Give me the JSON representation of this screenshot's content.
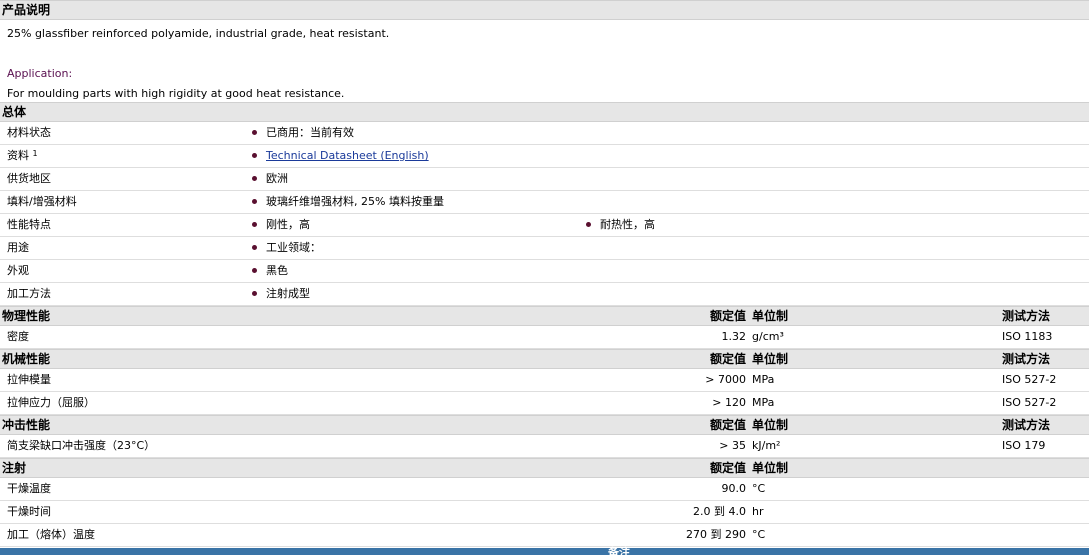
{
  "description": {
    "title": "产品说明",
    "line1": "25% glassfiber reinforced polyamide, industrial grade, heat resistant.",
    "app_label": "Application:",
    "app_text": "For moulding parts with high rigidity at good heat resistance."
  },
  "general": {
    "title": "总体",
    "rows": [
      {
        "label": "材料状态",
        "value": "已商用：当前有效"
      },
      {
        "label": "资料",
        "sup": "1",
        "value": "Technical Datasheet (English)"
      },
      {
        "label": "供货地区",
        "value": "欧洲"
      },
      {
        "label": "填料/增强材料",
        "value": "玻璃纤维增强材料, 25% 填料按重量"
      },
      {
        "label": "性能特点",
        "value": "刚性，高",
        "value2": "耐热性，高"
      },
      {
        "label": "用途",
        "value": "工业领域："
      },
      {
        "label": "外观",
        "value": "黑色"
      },
      {
        "label": "加工方法",
        "value": "注射成型"
      }
    ]
  },
  "headers": {
    "nominal": "额定值",
    "unit": "单位制",
    "test": "测试方法"
  },
  "physical": {
    "title": "物理性能",
    "rows": [
      {
        "label": "密度",
        "value": "1.32",
        "unit": "g/cm³",
        "test": "ISO 1183"
      }
    ]
  },
  "mechanical": {
    "title": "机械性能",
    "rows": [
      {
        "label": "拉伸模量",
        "value": "> 7000",
        "unit": "MPa",
        "test": "ISO 527-2"
      },
      {
        "label": "拉伸应力（屈服）",
        "value": "> 120",
        "unit": "MPa",
        "test": "ISO 527-2"
      }
    ]
  },
  "impact": {
    "title": "冲击性能",
    "rows": [
      {
        "label": "简支梁缺口冲击强度（23°C）",
        "value": "> 35",
        "unit": "kJ/m²",
        "test": "ISO 179"
      }
    ]
  },
  "injection": {
    "title": "注射",
    "rows": [
      {
        "label": "干燥温度",
        "value": "90.0",
        "unit": "°C"
      },
      {
        "label": "干燥时间",
        "value": "2.0 到  4.0",
        "unit": "hr"
      },
      {
        "label": "加工（熔体）温度",
        "value": "270 到  290",
        "unit": "°C"
      }
    ]
  },
  "footer": {
    "label": "备注"
  }
}
